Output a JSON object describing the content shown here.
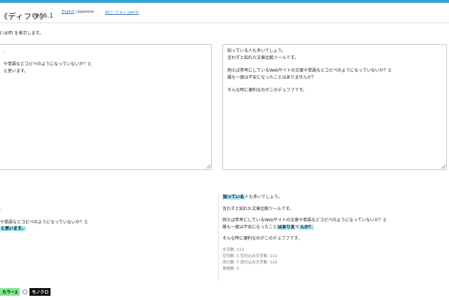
{
  "header": {
    "logo": "《ディフフ》",
    "version": "ver.6.1",
    "lang_english": "English",
    "lang_separator": "|",
    "lang_japanese": "Japanese",
    "old_version_link": "旧バージョン (ver.5)"
  },
  "description": "t (diff) を表示します。",
  "left_input": {
    "lines": [
      ".",
      "",
      "や単語などコピペのようになっていないか？と",
      "と思います。"
    ]
  },
  "right_input": {
    "paragraphs": [
      "知っている人も多いでしょう。\n言わずと知れた文章比較ツールです。",
      "例えば参考にしているWebサイトの文章や単語などコピペのようになっていないか？と\n誰も一度は不安になったことはありませんか？",
      "そんな時に便利なのがこのデュフフです。"
    ]
  },
  "left_result": {
    "line1": ".",
    "line2": "や単語などコピペのようになっていないか？と",
    "line3_highlight": "と思います。"
  },
  "right_result": {
    "p1_hl": "知っている",
    "p1_rest": "人も多いでしょう。",
    "p2": "言わずと知れた文章比較ツールです。",
    "p3_line1": "例えば参考にしているWebサイトの文章や単語などコピペのようになっていないか？と",
    "p3_line2_a": "誰も一度は不安になったこと",
    "p3_line2_hl1": "はありま",
    "p3_line2_b": "せ",
    "p3_line2_hl2": "んか？",
    "p4": "そんな時に便利なのがこのデュフフです。",
    "stats": [
      "文字数: 112",
      "空白数: 0  空白込み文字数: 112",
      "改行数: 7  改行込み文字数: 119",
      "単語数: 5"
    ]
  },
  "modes": {
    "color2": "カラー2",
    "mono": "モノクロ"
  },
  "colors": {
    "accent_bar": "#33a3d9",
    "highlight": "#9fe6f5",
    "color2_bg": "#7ee88f"
  }
}
